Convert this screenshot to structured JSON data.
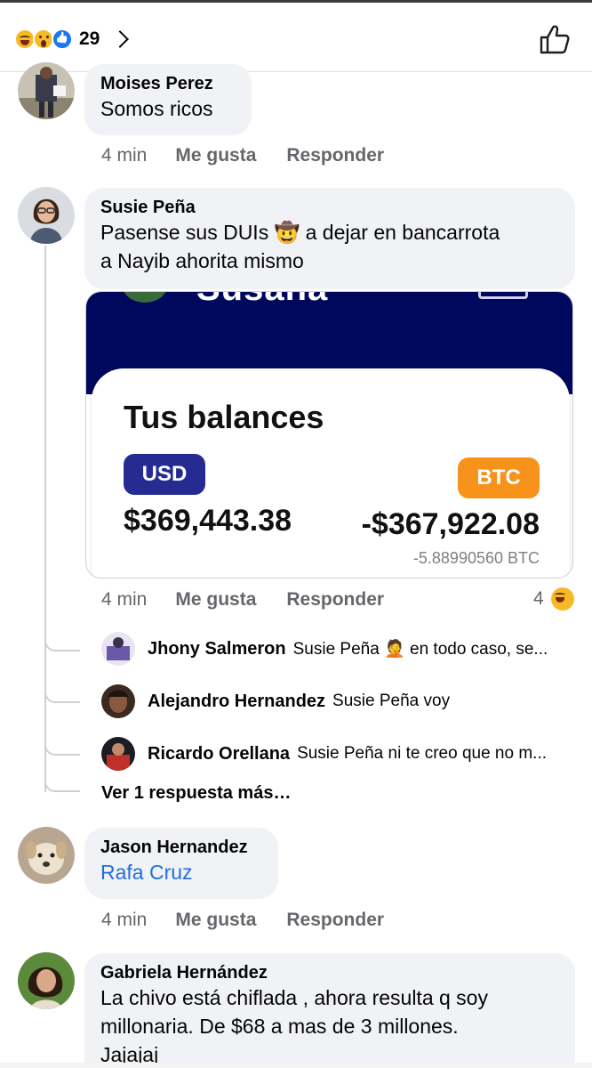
{
  "header": {
    "reaction_count": "29",
    "reaction_icons": [
      "haha-icon",
      "wow-icon",
      "like-icon"
    ]
  },
  "comments": [
    {
      "name": "Moises Perez",
      "text": "Somos ricos",
      "time": "4 min",
      "like_label": "Me gusta",
      "reply_label": "Responder"
    },
    {
      "name": "Susie Peña",
      "text_line1": "Pasense sus DUIs 🤠 a dejar en bancarrota",
      "text_line2": "a Nayib ahorita mismo",
      "time": "4 min",
      "like_label": "Me gusta",
      "reply_label": "Responder",
      "reaction_count": "4",
      "attachment": {
        "partial_name": "Susana",
        "title": "Tus balances",
        "usd_label": "USD",
        "usd_amount": "$369,443.38",
        "btc_label": "BTC",
        "btc_amount": "-$367,922.08",
        "btc_sub": "-5.88990560 BTC"
      },
      "replies": [
        {
          "name": "Jhony Salmeron",
          "text": "Susie Peña 🤦 en todo caso, se..."
        },
        {
          "name": "Alejandro Hernandez",
          "text": "Susie Peña voy"
        },
        {
          "name": "Ricardo Orellana",
          "text": "Susie Peña ni te creo que no m..."
        }
      ],
      "more_replies": "Ver 1 respuesta más…"
    },
    {
      "name": "Jason Hernandez",
      "text": "Rafa Cruz",
      "time": "4 min",
      "like_label": "Me gusta",
      "reply_label": "Responder"
    },
    {
      "name": "Gabriela Hernández",
      "text_line1": "La chivo está chiflada , ahora resulta q soy",
      "text_line2": "millonaria. De $68 a mas de 3 millones.",
      "text_line3": "Jajajaj"
    }
  ],
  "colors": {
    "bubble": "#f0f2f5",
    "meta_text": "#65676b",
    "link": "#216fdb",
    "navy": "#00085d",
    "usd_pill": "#252b91",
    "btc_pill": "#f7931a"
  }
}
